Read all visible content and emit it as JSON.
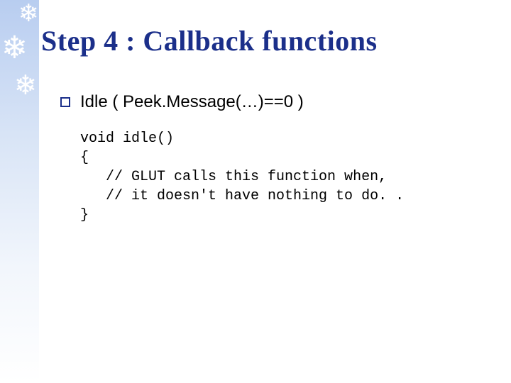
{
  "title": "Step 4 : Callback functions",
  "bullet": "Idle ( Peek.Message(…)==0 )",
  "code": "void idle()\n{\n   // GLUT calls this function when,\n   // it doesn't have nothing to do. .\n}"
}
